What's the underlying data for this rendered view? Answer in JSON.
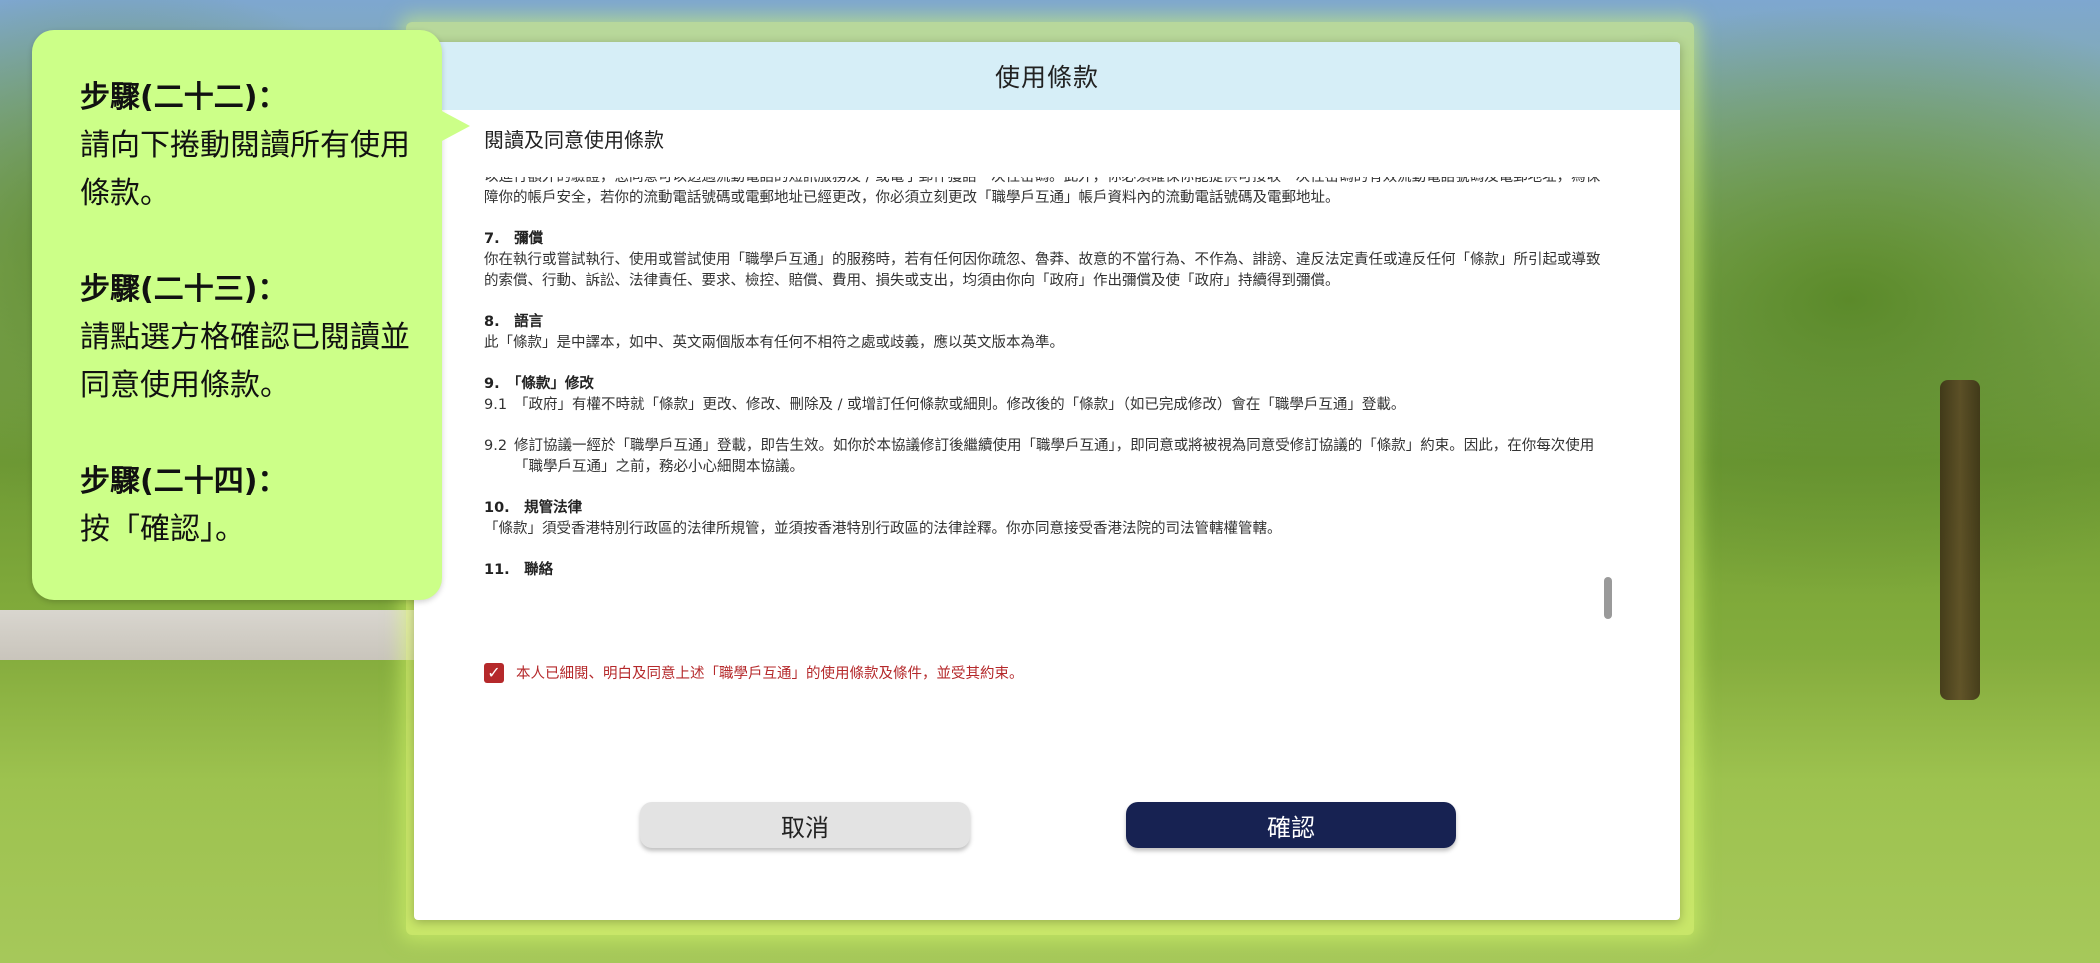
{
  "modal": {
    "title": "使用條款",
    "heading": "閱讀及同意使用條款",
    "terms_fragment_top": "以進行額外的驗證，您同意可以透過流動電話的短訊服務及 / 或電子郵件獲話一次性密碼。此外，你必須確保你能提供可接收一次性密碼的有效流動電話號碼及電郵地址，為保障你的帳戶安全，若你的流動電話號碼或電郵地址已經更改，你必須立刻更改「職學戶互通」帳戶資料內的流動電話號碼及電郵地址。",
    "clauses": [
      {
        "title": "7.　彌償",
        "text": "你在執行或嘗試執行、使用或嘗試使用「職學戶互通」的服務時，若有任何因你疏忽、魯莽、故意的不當行為、不作為、誹謗、違反法定責任或違反任何「條款」所引起或導致的索償、行動、訴訟、法律責任、要求、檢控、賠償、費用、損失或支出，均須由你向「政府」作出彌償及使「政府」持續得到彌償。"
      },
      {
        "title": "8.　語言",
        "text": "此「條款」是中譯本，如中、英文兩個版本有任何不相符之處或歧義，應以英文版本為準。"
      },
      {
        "title": "9.　「條款」修改",
        "text": ""
      },
      {
        "title": "10.　規管法律",
        "text": "「條款」須受香港特別行政區的法律所規管，並須按香港特別行政區的法律詮釋。你亦同意接受香港法院的司法管轄權管轄。"
      },
      {
        "title": "11.　聯絡",
        "text": ""
      }
    ],
    "sub_9_1_num": "9.1",
    "sub_9_1_text": "「政府」有權不時就「條款」更改、修改、刪除及 / 或增訂任何條款或細則。修改後的「條款」（如已完成修改）會在「職學戶互通」登載。",
    "sub_9_2_num": "9.2",
    "sub_9_2_text": "修訂協議一經於「職學戶互通」登載，即告生效。如你於本協議修訂後繼續使用「職學戶互通」，即同意或將被視為同意受修訂協議的「條款」約束。因此，在你每次使用「職學戶互通」之前，務必小心細閱本協議。",
    "agree_text": "本人已細閱、明白及同意上述「職學戶互通」的使用條款及條件，並受其約束。",
    "agree_checked": true,
    "cancel_label": "取消",
    "confirm_label": "確認",
    "colors": {
      "header_bg": "#d6eef7",
      "confirm_bg": "#172252",
      "agree_red": "#b5292b",
      "callout_bg": "#ccff88"
    }
  },
  "callout": {
    "steps": [
      {
        "title": "步驟(二十二)：",
        "text": "請向下捲動閱讀所有使用條款。"
      },
      {
        "title": "步驟(二十三)：",
        "text": "請點選方格確認已閱讀並同意使用條款。"
      },
      {
        "title": "步驟(二十四)：",
        "text": "按「確認」。"
      }
    ]
  }
}
